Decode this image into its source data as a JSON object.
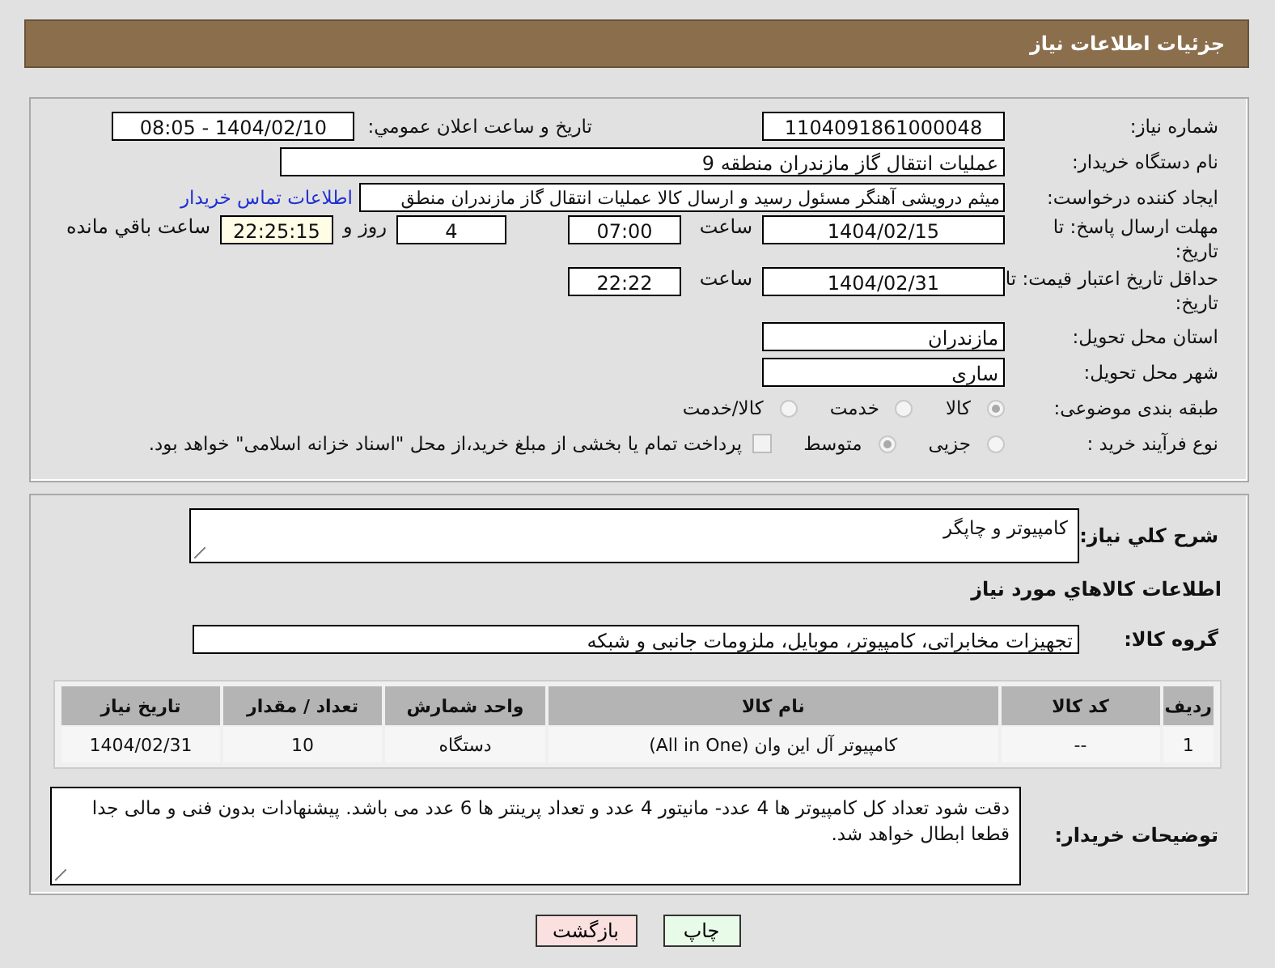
{
  "header": {
    "title": "جزئیات اطلاعات نیاز"
  },
  "info": {
    "need_number": {
      "label": "شماره نیاز:",
      "value": "1104091861000048"
    },
    "announce": {
      "label": "تاریخ و ساعت اعلان عمومي:",
      "value": "1404/02/10 - 08:05"
    },
    "buyer": {
      "label": "نام دستگاه خریدار:",
      "value": "عملیات انتقال گاز مازندران منطقه 9"
    },
    "creator": {
      "label": "ایجاد کننده درخواست:",
      "value": "میثم درویشی آهنگر مسئول رسید و ارسال کالا عملیات انتقال گاز مازندران منطق",
      "link": "اطلاعات تماس خریدار"
    },
    "deadline": {
      "label": "مهلت ارسال پاسخ: تا تاریخ:",
      "date": "1404/02/15",
      "time_label": "ساعت",
      "time": "07:00",
      "days": "4",
      "days_label": "روز و",
      "remaining": "22:25:15",
      "remaining_label": "ساعت باقي مانده"
    },
    "validity": {
      "label": "حداقل تاریخ اعتبار قیمت: تا تاریخ:",
      "date": "1404/02/31",
      "time_label": "ساعت",
      "time": "22:22"
    },
    "province": {
      "label": "استان محل تحویل:",
      "value": "مازندران"
    },
    "city": {
      "label": "شهر محل تحویل:",
      "value": "ساری"
    },
    "category": {
      "label": "طبقه بندی موضوعی:",
      "options": [
        {
          "label": "کالا",
          "selected": true
        },
        {
          "label": "خدمت",
          "selected": false
        },
        {
          "label": "کالا/خدمت",
          "selected": false
        }
      ]
    },
    "process": {
      "label": "نوع فرآیند خرید :",
      "options": [
        {
          "label": "جزیی",
          "selected": false
        },
        {
          "label": "متوسط",
          "selected": true
        }
      ],
      "treasury": {
        "checked": false,
        "text": "پرداخت تمام یا بخشی از مبلغ خرید،از محل \"اسناد خزانه اسلامی\" خواهد بود."
      }
    }
  },
  "details": {
    "summary": {
      "label": "شرح کلي نیاز:",
      "value": "کامپیوتر و چاپگر"
    },
    "goods_title": "اطلاعات کالاهاي مورد نیاز",
    "group": {
      "label": "گروه کالا:",
      "value": "تجهیزات مخابراتی، کامپیوتر، موبایل، ملزومات جانبی و شبکه"
    },
    "table": {
      "columns": [
        "ردیف",
        "کد کالا",
        "نام کالا",
        "واحد شمارش",
        "تعداد / مقدار",
        "تاریخ نیاز"
      ],
      "rows": [
        [
          "1",
          "--",
          "کامپیوتر آل این وان (All in One)",
          "دستگاه",
          "10",
          "1404/02/31"
        ]
      ]
    },
    "notes": {
      "label": "توضیحات خریدار:",
      "value": "دقت شود تعداد کل کامپیوتر ها 4 عدد- مانیتور 4 عدد و تعداد  پرینتر ها 6 عدد می باشد. پیشنهادات بدون فنی و مالی جدا قطعا ابطال خواهد شد."
    }
  },
  "buttons": [
    {
      "label": "چاپ",
      "kind": "print"
    },
    {
      "label": "بازگشت",
      "kind": "back"
    }
  ]
}
